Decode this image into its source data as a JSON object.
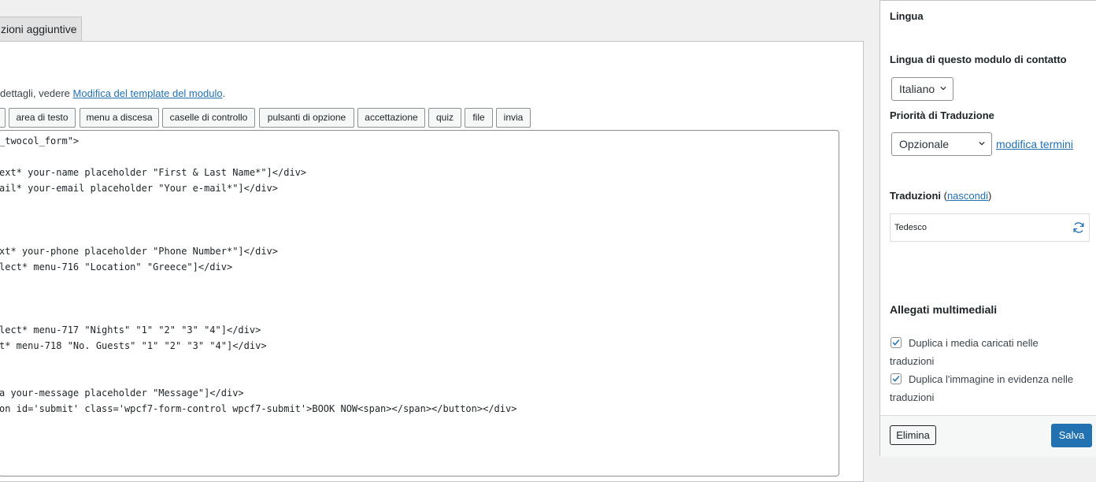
{
  "tabs": {
    "additional_settings": "zioni aggiuntive"
  },
  "help": {
    "prefix": "dettagli, vedere ",
    "link": "Modifica del template del modulo",
    "suffix": "."
  },
  "tag_buttons": [
    "area di testo",
    "menu a discesa",
    "caselle di controllo",
    "pulsanti di opzione",
    "accettazione",
    "quiz",
    "file",
    "invia"
  ],
  "code_lines": [
    "_twocol_form\">",
    "",
    "ext* your-name placeholder \"First & Last Name*\"]</div>",
    "ail* your-email placeholder \"Your e-mail*\"]</div>",
    "",
    "",
    "",
    "xt* your-phone placeholder \"Phone Number*\"]</div>",
    "lect* menu-716 \"Location\" \"Greece\"]</div>",
    "",
    "",
    "",
    "lect* menu-717 \"Nights\" \"1\" \"2\" \"3\" \"4\"]</div>",
    "t* menu-718 \"No. Guests\" \"1\" \"2\" \"3\" \"4\"]</div>",
    "",
    "",
    "a your-message placeholder \"Message\"]</div>",
    "on id='submit' class='wpcf7-form-control wpcf7-submit'>BOOK NOW<span></span></button></div>"
  ],
  "sidebar": {
    "title": "Lingua",
    "form_language_label": "Lingua di questo modulo di contatto",
    "language_value": "Italiano",
    "priority_label": "Priorità di Traduzione",
    "priority_value": "Opzionale",
    "edit_terms": "modifica termini",
    "translations_label": "Traduzioni",
    "hide_paren_open": " (",
    "hide_link": "nascondi",
    "hide_paren_close": ")",
    "translation_lang": "Tedesco",
    "media_title": "Allegati multimediali",
    "dup_media_line1": "Duplica i media caricati nelle",
    "dup_media_line2": "traduzioni",
    "dup_featured_line1": "Duplica l'immagine in evidenza nelle",
    "dup_featured_line2": "traduzioni",
    "delete_label": "Elimina",
    "save_label": "Salva"
  },
  "colors": {
    "accent": "#2271b1",
    "border": "#c3c4c7"
  }
}
